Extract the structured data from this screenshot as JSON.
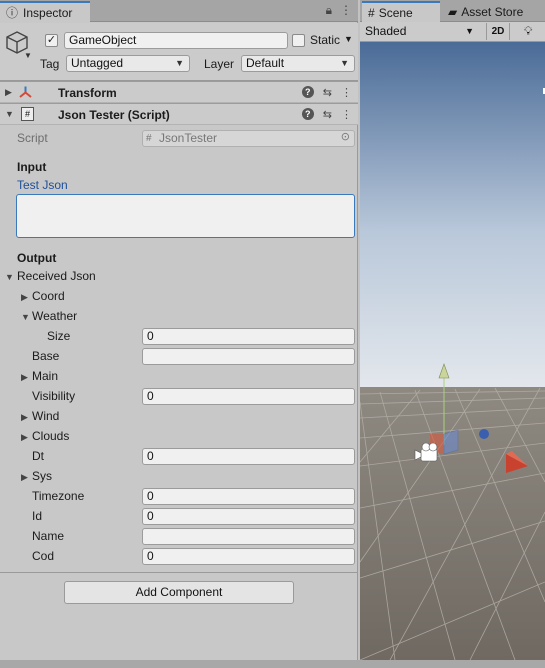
{
  "inspector": {
    "tab_label": "Inspector",
    "gameobject": {
      "active": true,
      "name": "GameObject",
      "static_label": "Static",
      "tag_label": "Tag",
      "tag_value": "Untagged",
      "layer_label": "Layer",
      "layer_value": "Default"
    },
    "transform": {
      "title": "Transform"
    },
    "script_component": {
      "title": "Json Tester (Script)",
      "script_label": "Script",
      "script_value": "JsonTester"
    },
    "input": {
      "header": "Input",
      "field_label": "Test Json",
      "field_value": ""
    },
    "output": {
      "header": "Output",
      "received_label": "Received Json",
      "coord": "Coord",
      "weather": "Weather",
      "size_label": "Size",
      "size_value": "0",
      "base_label": "Base",
      "base_value": "",
      "main": "Main",
      "visibility_label": "Visibility",
      "visibility_value": "0",
      "wind": "Wind",
      "clouds": "Clouds",
      "dt_label": "Dt",
      "dt_value": "0",
      "sys": "Sys",
      "timezone_label": "Timezone",
      "timezone_value": "0",
      "id_label": "Id",
      "id_value": "0",
      "name_label": "Name",
      "name_value": "",
      "cod_label": "Cod",
      "cod_value": "0"
    },
    "add_component": "Add Component"
  },
  "scene": {
    "tab_scene": "Scene",
    "tab_asset_store": "Asset Store",
    "shading_mode": "Shaded",
    "toggle_2d": "2D"
  },
  "colors": {
    "accent": "#3a79bb",
    "sky_top": "#4a6b97",
    "sky_horizon": "#e3e7ec",
    "ground": "#77716a"
  }
}
